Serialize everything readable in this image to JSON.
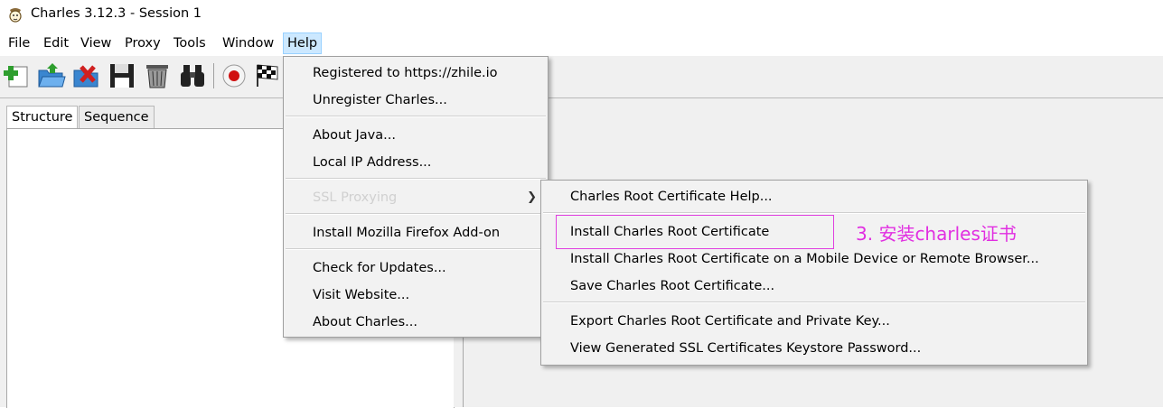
{
  "window": {
    "title": "Charles 3.12.3 - Session 1"
  },
  "menubar": {
    "items": [
      "File",
      "Edit",
      "View",
      "Proxy",
      "Tools",
      "Window",
      "Help"
    ],
    "active": "Help"
  },
  "toolbar": {
    "icons": [
      "new-session-icon",
      "open-session-icon",
      "close-session-icon",
      "save-session-icon",
      "clear-session-icon",
      "find-icon",
      "record-icon",
      "throttle-icon"
    ]
  },
  "tabs": {
    "structure": "Structure",
    "sequence": "Sequence"
  },
  "help_menu": {
    "items": [
      "Registered to https://zhile.io",
      "Unregister Charles...",
      "About Java...",
      "Local IP Address...",
      "SSL Proxying",
      "Install Mozilla Firefox Add-on",
      "Check for Updates...",
      "Visit Website...",
      "About Charles..."
    ]
  },
  "ssl_submenu": {
    "items": [
      "Charles Root Certificate Help...",
      "Install Charles Root Certificate",
      "Install Charles Root Certificate on a Mobile Device or Remote Browser...",
      "Save Charles Root Certificate...",
      "Export Charles Root Certificate and Private Key...",
      "View Generated SSL Certificates Keystore Password..."
    ]
  },
  "annotation": {
    "text": "3. 安装charles证书",
    "color": "#e12fe1"
  }
}
